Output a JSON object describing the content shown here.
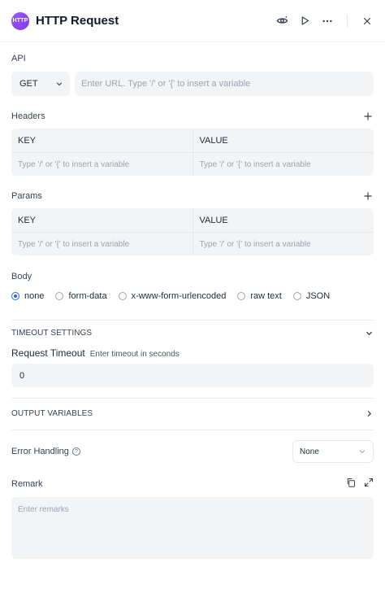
{
  "node": {
    "icon_text": "HTTP",
    "title": "HTTP Request",
    "icon_color": "#8b5cf6"
  },
  "header_actions": [
    "eye-icon",
    "play-icon",
    "more-icon",
    "close-icon"
  ],
  "api": {
    "label": "API",
    "method": "GET",
    "url_placeholder": "Enter URL. Type '/' or '{' to insert a variable"
  },
  "headers": {
    "label": "Headers",
    "key_col": "KEY",
    "value_col": "VALUE",
    "key_placeholder": "Type '/' or '{' to insert a variable",
    "value_placeholder": "Type '/' or '{' to insert a variable"
  },
  "params": {
    "label": "Params",
    "key_col": "KEY",
    "value_col": "VALUE",
    "key_placeholder": "Type '/' or '{' to insert a variable",
    "value_placeholder": "Type '/' or '{' to insert a variable"
  },
  "body": {
    "label": "Body",
    "options": [
      "none",
      "form-data",
      "x-www-form-urlencoded",
      "raw text",
      "JSON"
    ],
    "selected": "none"
  },
  "timeout": {
    "section": "TIMEOUT SETTINGS",
    "title": "Request Timeout",
    "hint": "Enter timeout in seconds",
    "value": "0"
  },
  "output": {
    "section": "OUTPUT VARIABLES"
  },
  "error_handling": {
    "label": "Error Handling",
    "value": "None"
  },
  "remark": {
    "label": "Remark",
    "placeholder": "Enter remarks"
  },
  "colors": {
    "accent": "#2563eb",
    "input_bg": "#f3f4f6"
  }
}
